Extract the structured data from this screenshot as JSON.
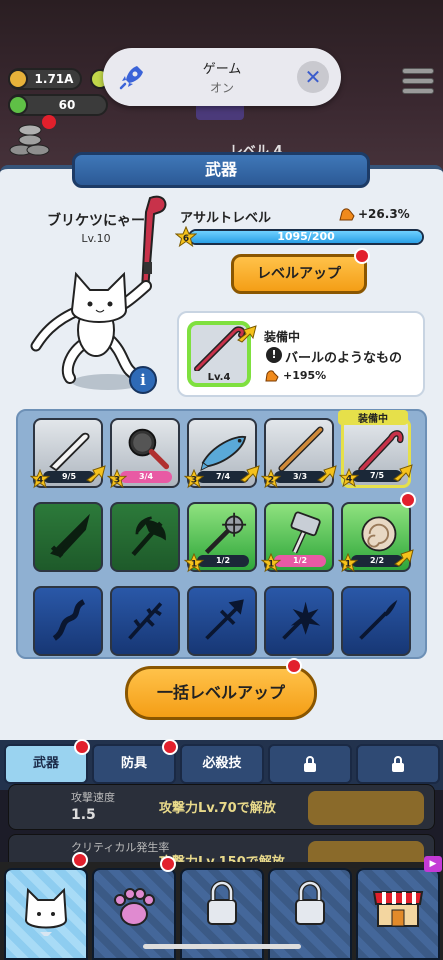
{
  "toast": {
    "title": "ゲーム",
    "subtitle": "オン"
  },
  "resources": {
    "coins": "1.71A",
    "gems": "60"
  },
  "background_text": "レベル 4",
  "panel": {
    "title": "武器"
  },
  "character": {
    "name": "ブリケツにゃー",
    "level": "Lv.10"
  },
  "assault": {
    "label": "アサルトレベル",
    "bonus": "+26.3%",
    "star_level": "6",
    "progress_text": "1095/200",
    "progress_fraction": 1.0
  },
  "level_up_button": "レベルアップ",
  "equipped": {
    "header": "装備中",
    "name": "バールのようなもの",
    "bonus": "+195%",
    "thumb_level": "Lv.4"
  },
  "equipped_tag": "装備中",
  "weapons": [
    {
      "item": "bat",
      "stars": "4",
      "count": "9/5",
      "style": "gray",
      "upgradable": true
    },
    {
      "item": "frying-pan",
      "stars": "3",
      "count": "3/4",
      "style": "gray",
      "pink": true
    },
    {
      "item": "fish",
      "stars": "3",
      "count": "7/4",
      "style": "gray",
      "upgradable": true
    },
    {
      "item": "wooden-staff",
      "stars": "2",
      "count": "3/3",
      "style": "gray",
      "upgradable": true
    },
    {
      "item": "crowbar",
      "stars": "4",
      "count": "7/5",
      "style": "gray",
      "upgradable": true
    },
    {
      "item": "sword-silhouette",
      "style": "dgreen"
    },
    {
      "item": "axe-silhouette",
      "style": "dgreen"
    },
    {
      "item": "mace",
      "stars": "1",
      "count": "1/2",
      "style": "green"
    },
    {
      "item": "hammer",
      "stars": "1",
      "count": "1/2",
      "style": "green",
      "pink": true
    },
    {
      "item": "ammonite",
      "stars": "1",
      "count": "2/2",
      "style": "green",
      "upgradable": true
    },
    {
      "item": "whip-silhouette",
      "style": "blue"
    },
    {
      "item": "branch-silhouette",
      "style": "blue"
    },
    {
      "item": "spear-silhouette",
      "style": "blue"
    },
    {
      "item": "star-mace-silhouette",
      "style": "blue"
    },
    {
      "item": "brush-silhouette",
      "style": "blue"
    }
  ],
  "bulk_button": "一括レベルアップ",
  "tabs": [
    {
      "label": "武器",
      "active": true,
      "dot": true
    },
    {
      "label": "防具",
      "dot": true
    },
    {
      "label": "必殺技"
    },
    {
      "label": "",
      "locked": true
    },
    {
      "label": "",
      "locked": true
    }
  ],
  "rows": [
    {
      "r1": "攻撃速度",
      "r2": "1.5",
      "mid": "攻撃力Lv.70で解放"
    },
    {
      "r1": "クリティカル発生率",
      "r2": "",
      "mid": "攻撃力Lv.150で解放"
    }
  ],
  "colors": {
    "accent": "#f49e16",
    "progress": "#2aa0e6",
    "badge": "#e2202c"
  }
}
